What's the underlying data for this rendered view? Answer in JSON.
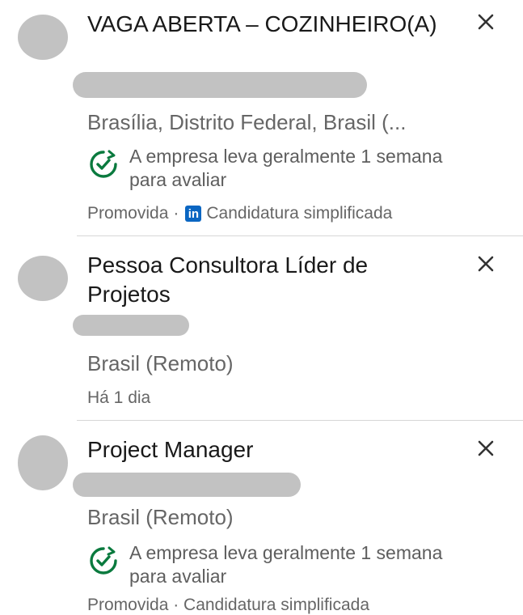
{
  "jobs": [
    {
      "title": "VAGA ABERTA – COZINHEIRO(A)",
      "location": "Brasília, Distrito Federal, Brasil (...",
      "insight": "A empresa leva geralmente 1 semana para avaliar",
      "footer_promoted": "Promovida",
      "footer_separator": "·",
      "footer_apply": "Candidatura simplificada",
      "logo_icon": "linkedin-icon"
    },
    {
      "title": "Pessoa Consultora Líder de Projetos",
      "location": "Brasil (Remoto)",
      "posted": "Há 1 dia"
    },
    {
      "title": "Project Manager",
      "location": "Brasil (Remoto)",
      "insight": "A empresa leva geralmente 1 semana para avaliar",
      "footer_partial": "Promovida · Candidatura simplificada"
    }
  ],
  "icons": {
    "close": "close-icon",
    "insight": "check-clock-icon",
    "linkedin": "linkedin-icon"
  },
  "colors": {
    "insight_icon": "#0a7a3e",
    "linkedin": "#0a66c2",
    "placeholder": "#c2c2c2"
  }
}
